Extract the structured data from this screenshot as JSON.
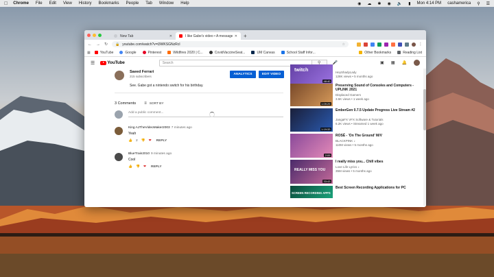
{
  "menubar": {
    "app": "Chrome",
    "menus": [
      "File",
      "Edit",
      "View",
      "History",
      "Bookmarks",
      "People",
      "Tab",
      "Window",
      "Help"
    ],
    "clock": "Mon 4:14 PM",
    "user": "cashamerica"
  },
  "browser": {
    "tabs": [
      {
        "label": "New Tab",
        "active": false
      },
      {
        "label": "I like Gabe's video • A message",
        "active": true
      }
    ],
    "url": "youtube.com/watch?v=t3WKSGNzRcI",
    "bookmarks": [
      "YouTube",
      "Google",
      "Pinterest",
      "Wildfires 2020 | C...",
      "CovidVaccineSeat...",
      "UM Canvas",
      "School Staff Infor..."
    ],
    "bookmarks_right": [
      "Other Bookmarks",
      "Reading List"
    ]
  },
  "youtube": {
    "search_placeholder": "Search",
    "channel": {
      "name": "Saeed Ferrari",
      "subscribers": "215 subscribers",
      "description": "See. Gabe got a nintendo switch for his birthday.",
      "analytics_label": "ANALYTICS",
      "edit_label": "EDIT VIDEO"
    },
    "comments_header": "3 Comments",
    "sort_label": "SORT BY",
    "add_placeholder": "Add a public comment...",
    "comments": [
      {
        "author": "King AJTheVideoMaker2003",
        "time": "7 minutes ago",
        "text": "Yeah",
        "likes": "2",
        "reply": "REPLY",
        "avatar_color": "#7b5c3a"
      },
      {
        "author": "BlueTrain2010",
        "time": "9 minutes ago",
        "text": "Cool",
        "likes": "",
        "reply": "REPLY",
        "avatar_color": "#4a4a4a"
      }
    ],
    "recommendations": [
      {
        "title": "Preserving Sound of Consoles and Computers - UPLINK 2021",
        "channel": "Displaced Gamers",
        "meta": "3.5K views • 1 week ago",
        "duration": "1:09:29",
        "thumb_text": "",
        "colors": [
          "#7a4a2a",
          "#d69a5a"
        ]
      },
      {
        "title": "EmberGen 0.7.5 Update Progress Live Stream #2",
        "channel": "JangaFX VFX Software & Tutorials",
        "meta": "6.2K views • Streamed 1 week ago",
        "duration": "1:19:33",
        "thumb_text": "",
        "colors": [
          "#1a1f3a",
          "#2a5ab0"
        ]
      },
      {
        "title": "ROSÉ - 'On The Ground' M/V",
        "channel": "BLACKPINK ♪",
        "meta": "110M views • 5 months ago",
        "duration": "2:09",
        "thumb_text": "",
        "colors": [
          "#8a4a9a",
          "#e48ab8"
        ]
      },
      {
        "title": "I really miss you... Chill vibes",
        "channel": "Love Life Lyrics ♪",
        "meta": "35M views • 5 months ago",
        "duration": "33:43",
        "thumb_text": "REALLY MISS YOU",
        "colors": [
          "#4a2a6a",
          "#c46a9a"
        ]
      },
      {
        "title": "Best Screen Recording Applications for PC",
        "channel": "",
        "meta": "",
        "duration": "",
        "thumb_text": "SCREEN RECORDING APPS",
        "colors": [
          "#0a4a3a",
          "#1aa27a"
        ]
      }
    ],
    "top_rec": {
      "channel": "HeyShadyLady",
      "meta": "128K views • 5 months ago",
      "duration": "48:40",
      "thumb_text": "twitch",
      "colors": [
        "#6441a5",
        "#9b72e0"
      ]
    }
  }
}
